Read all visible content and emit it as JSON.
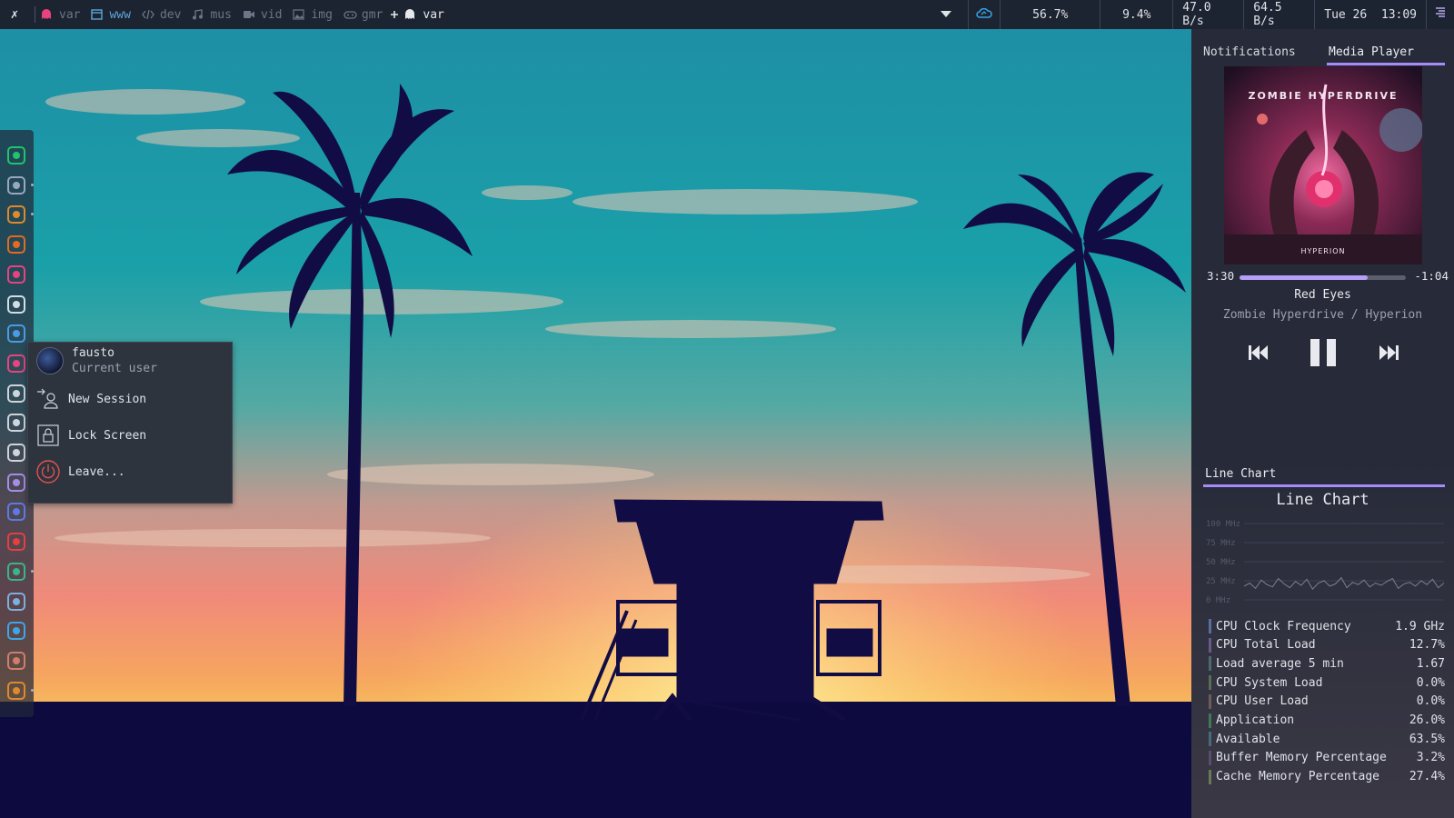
{
  "topbar": {
    "logo": "✗",
    "workspaces": [
      {
        "name": "var",
        "icon": "ghost-icon",
        "state": "active"
      },
      {
        "name": "www",
        "icon": "browser-window-icon",
        "state": "normal"
      },
      {
        "name": "dev",
        "icon": "code-icon",
        "state": "normal"
      },
      {
        "name": "mus",
        "icon": "music-note-icon",
        "state": "normal"
      },
      {
        "name": "vid",
        "icon": "video-camera-icon",
        "state": "normal"
      },
      {
        "name": "img",
        "icon": "image-icon",
        "state": "normal"
      },
      {
        "name": "gmr",
        "icon": "gamepad-icon",
        "state": "normal"
      }
    ],
    "current_window": "var",
    "status": {
      "cpu": "56.7%",
      "mem": "9.4%",
      "net_down": "47.0 B/s",
      "net_up": "64.5 B/s",
      "clock": "Tue 26  13:09"
    }
  },
  "dock": {
    "icons": [
      "spotify-icon",
      "folder-icon",
      "brave-browser-icon",
      "firefox-icon",
      "text-editor-icon",
      "font-icon",
      "brush-icon",
      "git-icon",
      "compass-icon",
      "cursor-icon",
      "graph-icon",
      "camera-icon",
      "kdenlive-icon",
      "vlc-cone-icon",
      "discord-icon",
      "terminal-icon",
      "system-monitor-icon",
      "hammer-icon",
      "settings-gear-icon"
    ]
  },
  "userpop": {
    "username": "fausto",
    "subtitle": "Current user",
    "items": [
      {
        "label": "New Session",
        "icon": "new-session-icon"
      },
      {
        "label": "Lock Screen",
        "icon": "lock-icon"
      },
      {
        "label": "Leave...",
        "icon": "power-icon"
      }
    ]
  },
  "rpanel": {
    "tabs": [
      "Notifications",
      "Media Player"
    ],
    "cover_band": "ZOMBIE HYPERDRIVE",
    "cover_album": "HYPERION",
    "time_elapsed": "3:30",
    "time_remaining": "-1:04",
    "progress": 0.77,
    "song_title": "Red Eyes",
    "song_artist": "Zombie Hyperdrive / Hyperion",
    "linechart_tab": "Line Chart",
    "linechart_title": "Line Chart"
  },
  "chart_data": {
    "type": "line",
    "title": "Line Chart",
    "y_ticks": [
      "100 MHz",
      "75 MHz",
      "50 MHz",
      "25 MHz",
      "0 MHz"
    ],
    "ylim": [
      0,
      100
    ],
    "series": [
      {
        "values": [
          18,
          22,
          15,
          26,
          20,
          17,
          28,
          21,
          16,
          24,
          19,
          27,
          14,
          22,
          25,
          18,
          21,
          29,
          16,
          23,
          20,
          26,
          17,
          22,
          19,
          24,
          28,
          15,
          21,
          23,
          18,
          25,
          20,
          27,
          16,
          22
        ]
      }
    ]
  },
  "sensors": [
    {
      "label": "CPU Clock Frequency",
      "value": "1.9 GHz",
      "color": "#5b6d9a"
    },
    {
      "label": "CPU Total Load",
      "value": "12.7%",
      "color": "#6a5a8a"
    },
    {
      "label": "Load average 5 min",
      "value": "1.67",
      "color": "#4d6b6a"
    },
    {
      "label": "CPU System Load",
      "value": "0.0%",
      "color": "#5a6d58"
    },
    {
      "label": "CPU User Load",
      "value": "0.0%",
      "color": "#6d5d5a"
    },
    {
      "label": "Application",
      "value": "26.0%",
      "color": "#3d7a55"
    },
    {
      "label": "Available",
      "value": "63.5%",
      "color": "#4a6a7a"
    },
    {
      "label": "Buffer Memory Percentage",
      "value": "3.2%",
      "color": "#5a4d6d"
    },
    {
      "label": "Cache Memory Percentage",
      "value": "27.4%",
      "color": "#6a7a58"
    }
  ]
}
